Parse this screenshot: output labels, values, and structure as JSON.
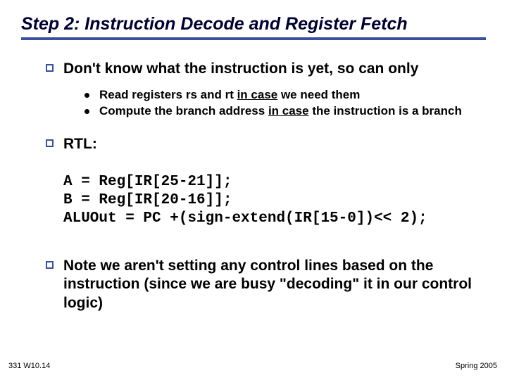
{
  "title": "Step 2:  Instruction Decode and Register Fetch",
  "b1": "Don't know what the instruction is yet, so can only",
  "s1a": "Read registers rs and rt ",
  "s1b": "in case",
  "s1c": " we need them",
  "s2a": "Compute the branch address ",
  "s2b": "in case",
  "s2c": " the instruction is a branch",
  "b2": "RTL:",
  "code": "A = Reg[IR[25-21]];\nB = Reg[IR[20-16]];\nALUOut = PC +(sign-extend(IR[15-0])<< 2);",
  "b3": "Note we aren't setting any control lines based on the instruction (since we are busy \"decoding\" it in our control logic)",
  "footer_left": "331 W10.14",
  "footer_right": "Spring 2005"
}
